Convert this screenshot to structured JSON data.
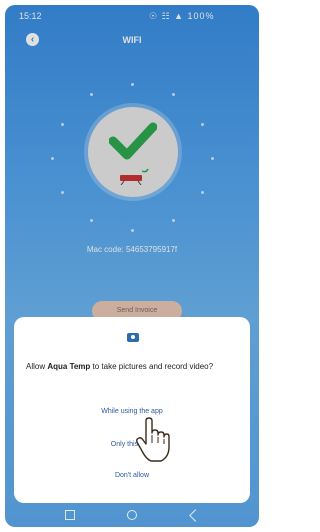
{
  "status_bar": {
    "time": "15:12",
    "icons": "☉ ☷ ▲ 100%"
  },
  "header": {
    "title": "WIFI"
  },
  "mac_code": "Mac code: 54653795917f",
  "send_button": "Send Invoice",
  "dialog": {
    "prompt_prefix": "Allow ",
    "app_name": "Aqua Temp",
    "prompt_suffix": " to take pictures and record video?",
    "options": [
      "While using the app",
      "Only this time",
      "Don't allow"
    ]
  },
  "colors": {
    "accent": "#3a8ee3",
    "check": "#2ea84f",
    "link": "#2b5a9e"
  }
}
